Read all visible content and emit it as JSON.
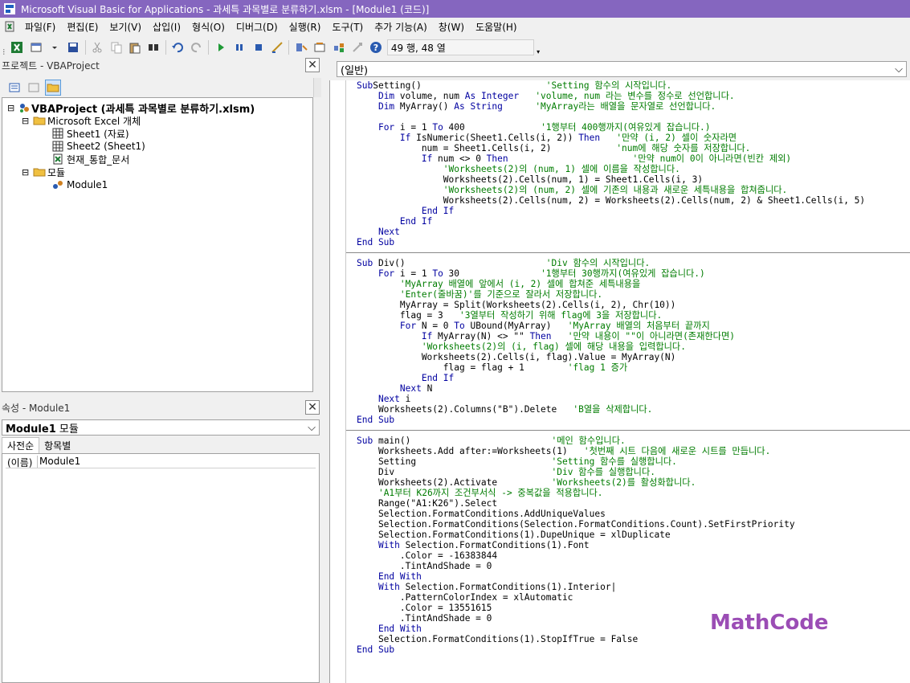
{
  "window": {
    "title": "Microsoft Visual Basic for Applications - 과세특 과목별로 분류하기.xlsm - [Module1 (코드)]"
  },
  "menu": {
    "items": [
      "파일(F)",
      "편집(E)",
      "보기(V)",
      "삽입(I)",
      "형식(O)",
      "디버그(D)",
      "실행(R)",
      "도구(T)",
      "추가 기능(A)",
      "창(W)",
      "도움말(H)"
    ]
  },
  "toolbar": {
    "position": "49 행, 48 열"
  },
  "project": {
    "title": "프로젝트 - VBAProject",
    "root": "VBAProject (과세특 과목별로 분류하기.xlsm)",
    "excel_folder": "Microsoft Excel 개체",
    "sheet1": "Sheet1 (자료)",
    "sheet2": "Sheet2 (Sheet1)",
    "workbook": "현재_통합_문서",
    "modules_folder": "모듈",
    "module1": "Module1"
  },
  "properties": {
    "title": "속성 - Module1",
    "object_name": "Module1",
    "object_type": "모듈",
    "tab_alpha": "사전순",
    "tab_category": "항목별",
    "row_key": "(이름)",
    "row_value": "Module1"
  },
  "code_window": {
    "object_combo": "(일반)"
  },
  "watermark": "MathCode",
  "icons": {
    "app": "vba-app-icon",
    "excel": "excel-icon",
    "folder": "folder-icon",
    "sheet": "sheet-icon",
    "module": "module-icon",
    "project": "project-icon"
  }
}
